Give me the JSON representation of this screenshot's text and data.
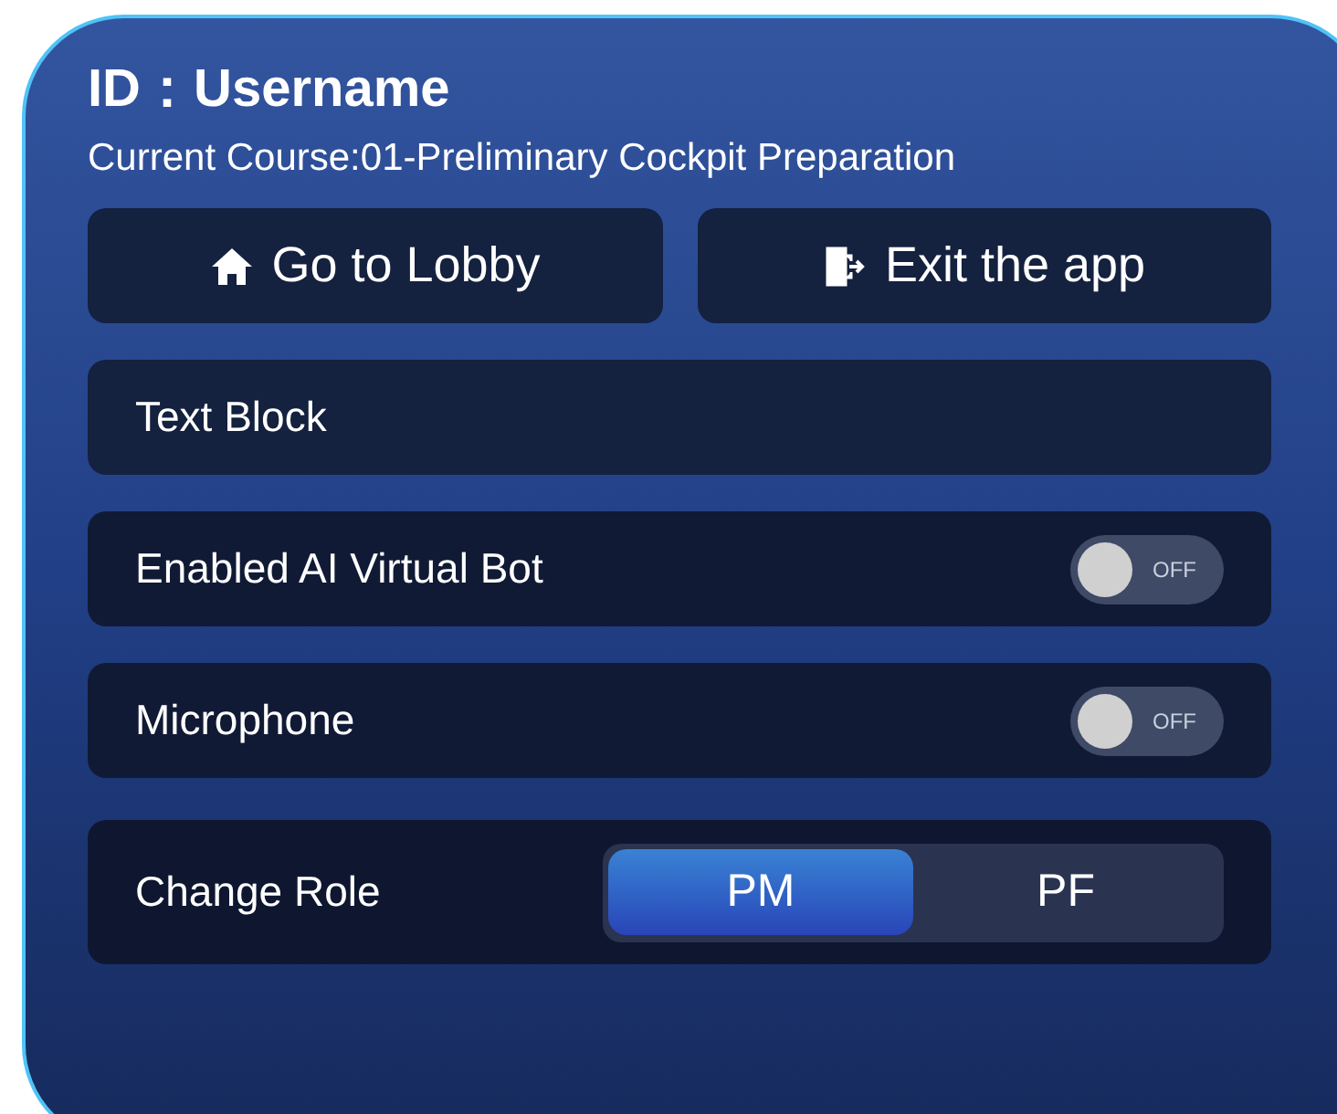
{
  "header": {
    "title": "ID：Username",
    "course": "Current Course:01-Preliminary Cockpit Preparation"
  },
  "buttons": [
    {
      "label": "Go to Lobby",
      "kind": "home"
    },
    {
      "label": "Exit the app",
      "kind": "exit"
    }
  ],
  "text_block": "Text Block",
  "settings": [
    {
      "label": "Enabled AI Virtual Bot",
      "on": false,
      "toggle_text": "OFF"
    },
    {
      "label": "Microphone",
      "on": false,
      "toggle_text": "OFF"
    }
  ],
  "role": {
    "label": "Change Role",
    "options": [
      {
        "label": "PM",
        "selected": true
      },
      {
        "label": "PF",
        "selected": false
      }
    ]
  }
}
